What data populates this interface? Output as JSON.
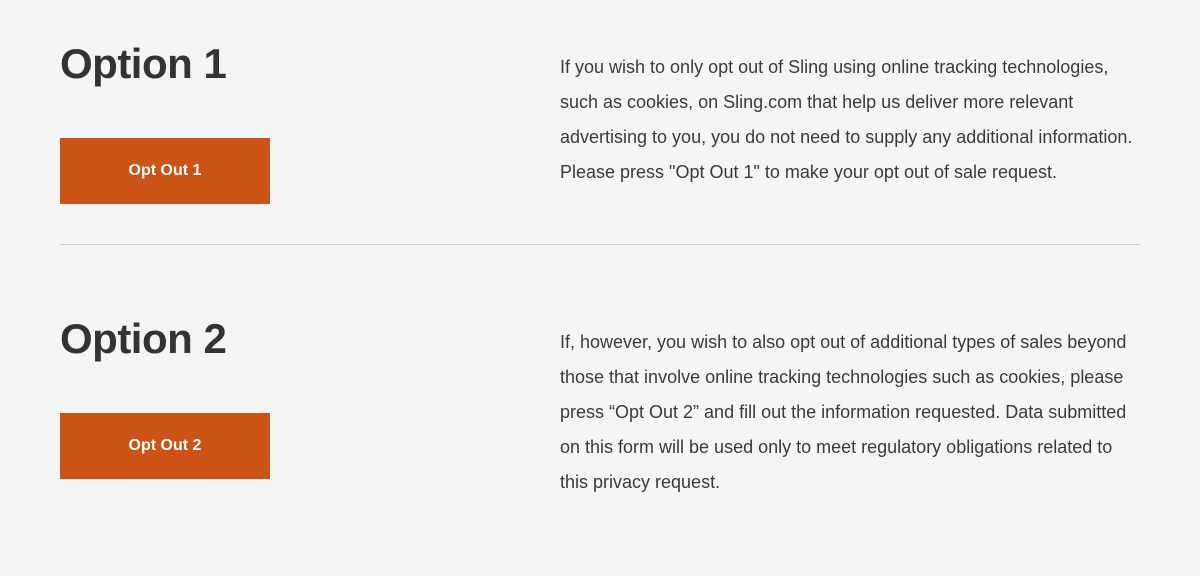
{
  "options": [
    {
      "title": "Option 1",
      "button_label": "Opt Out 1",
      "description": "If you wish to only opt out of Sling using online tracking technologies, such as cookies, on Sling.com that help us deliver more relevant advertising to you, you do not need to supply any additional information. Please press \"Opt Out 1\" to make your opt out of sale request."
    },
    {
      "title": "Option 2",
      "button_label": "Opt Out 2",
      "description": "If, however, you wish to also opt out of additional types of sales beyond those that involve online tracking technologies such as cookies, please press “Opt Out 2” and fill out the information requested. Data submitted on this form will be used only to meet regulatory obligations related to this privacy request."
    }
  ]
}
